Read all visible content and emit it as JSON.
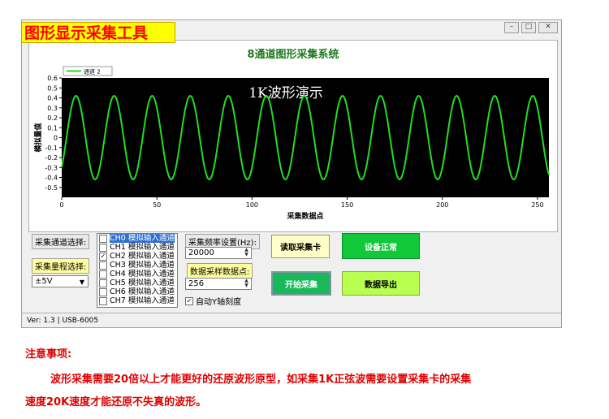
{
  "banner": {
    "text": "图形显示采集工具"
  },
  "window": {
    "controls": {
      "minimize": "–",
      "maximize": "□",
      "close": "✕"
    },
    "title": "8通道图形采集系统",
    "status": "Ver: 1.3  | USB-6005"
  },
  "chart_data": {
    "type": "line",
    "title": "8通道图形采集系统",
    "annotation": "1K波形演示",
    "xlabel": "采集数据点",
    "ylabel": "模拟量值",
    "xlim": [
      0,
      256
    ],
    "ylim": [
      -0.6,
      0.6
    ],
    "xticks": [
      0,
      50,
      100,
      150,
      200,
      250
    ],
    "yticks": [
      0.6,
      0.5,
      0.4,
      0.3,
      0.2,
      0.1,
      0,
      -0.1,
      -0.2,
      -0.3,
      -0.4,
      -0.5
    ],
    "ytick_labels": [
      "0.6",
      "0.5",
      "0.4",
      "0.3",
      "0.2",
      "0.1",
      "0",
      "-0.1",
      "-0.2",
      "-0.3",
      "-0.4",
      "-0.5"
    ],
    "legend": {
      "position": "top-left",
      "entries": [
        "通道 2"
      ]
    },
    "background": "#000000",
    "line_color": "#22dd22",
    "series": [
      {
        "name": "通道 2",
        "kind": "sine",
        "amplitude": 0.42,
        "offset": 0,
        "period_points": 20,
        "phase_start_value": -0.3,
        "x_start": 0,
        "x_end": 256
      }
    ]
  },
  "controls": {
    "channel_select_label": "采集通道选择:",
    "range_select_label": "采集量程选择:",
    "range_value": "±5V",
    "channels": [
      {
        "label": "CH0 模拟输入通道",
        "checked": false,
        "selected": true
      },
      {
        "label": "CH1 模拟输入通道",
        "checked": false,
        "selected": false
      },
      {
        "label": "CH2 模拟输入通道",
        "checked": true,
        "selected": false
      },
      {
        "label": "CH3 模拟输入通道",
        "checked": false,
        "selected": false
      },
      {
        "label": "CH4 模拟输入通道",
        "checked": false,
        "selected": false
      },
      {
        "label": "CH5 模拟输入通道",
        "checked": false,
        "selected": false
      },
      {
        "label": "CH6 模拟输入通道",
        "checked": false,
        "selected": false
      },
      {
        "label": "CH7 模拟输入通道",
        "checked": false,
        "selected": false
      }
    ],
    "freq_label": "采集频率设置(Hz):",
    "freq_value": "20000",
    "points_label": "数据采样数据点:",
    "points_value": "256",
    "auto_y_label": "自动Y轴刻度",
    "auto_y_checked": true,
    "read_card_button": "读取采集卡",
    "device_status_button": "设备正常",
    "start_button": "开始采集",
    "export_button": "数据导出"
  },
  "notes": {
    "title": "注意事项:",
    "line1": "波形采集需要20倍以上才能更好的还原波形原型，如采集1K正弦波需要设置采集卡的采集",
    "line2": "速度20K速度才能还原不失真的波形。"
  },
  "colors": {
    "accent_red": "#e00000",
    "banner_yellow": "#ffff00",
    "title_green": "#1e7a1e",
    "wave_green": "#22dd22"
  }
}
